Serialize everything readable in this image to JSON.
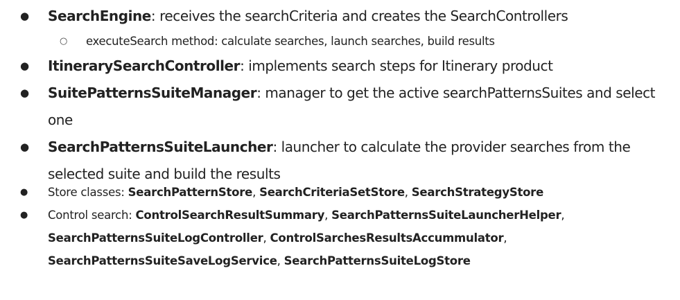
{
  "section_main": {
    "items": [
      {
        "name": "SearchEngine",
        "desc": ": receives the searchCriteria and creates the SearchControllers"
      },
      {
        "name": "ItinerarySearchController",
        "desc": ": implements search steps for Itinerary product"
      },
      {
        "name": "SuitePatternsSuiteManager",
        "desc": ": manager to get the active searchPatternsSuites and select one"
      },
      {
        "name": "SearchPatternsSuiteLauncher",
        "desc": ": launcher to calculate the provider searches from the",
        "desc_cont": "selected suite and build the results"
      }
    ],
    "sub_item": "executeSearch method: calculate searches, launch searches, build results"
  },
  "section_secondary": {
    "store": {
      "label": "Store classes: ",
      "classes": [
        "SearchPatternStore",
        "SearchCriteriaSetStore",
        "SearchStrategyStore"
      ],
      "sep": ", "
    },
    "control": {
      "label": "Control search: ",
      "classes": [
        "ControlSearchResultSummary",
        "SearchPatternsSuiteLauncherHelper",
        "SearchPatternsSuiteLogController",
        "ControlSarchesResultsAccummulator",
        "SearchPatternsSuiteSaveLogService",
        "SearchPatternsSuiteLogStore"
      ],
      "sep": ","
    }
  }
}
